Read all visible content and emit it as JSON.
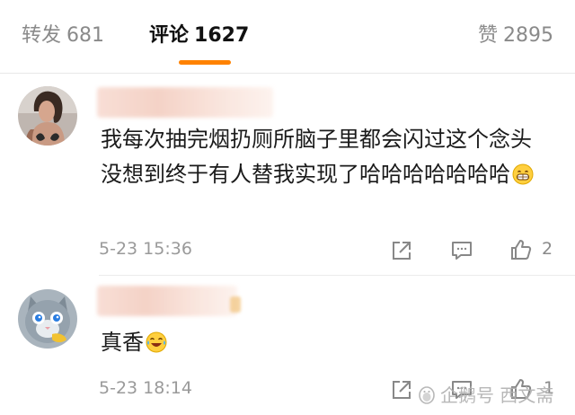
{
  "tabs": [
    {
      "label": "转发",
      "count": "681",
      "active": false
    },
    {
      "label": "评论",
      "count": "1627",
      "active": true
    },
    {
      "label": "赞",
      "count": "2895",
      "active": false
    }
  ],
  "accent_color": "#ff8200",
  "comments": [
    {
      "avatar": "woman-photo-avatar",
      "text": "我每次抽完烟扔厕所脑子里都会闪过这个念头 没想到终于有人替我实现了哈哈哈哈哈哈哈",
      "emoji": "grin-emoji",
      "time": "5-23 15:36",
      "likes": "2"
    },
    {
      "avatar": "cat-avatar",
      "text": "真香",
      "emoji": "laugh-cry-emoji",
      "time": "5-23 18:14",
      "likes": "1"
    }
  ],
  "watermark": "企鹅号 西文斋"
}
